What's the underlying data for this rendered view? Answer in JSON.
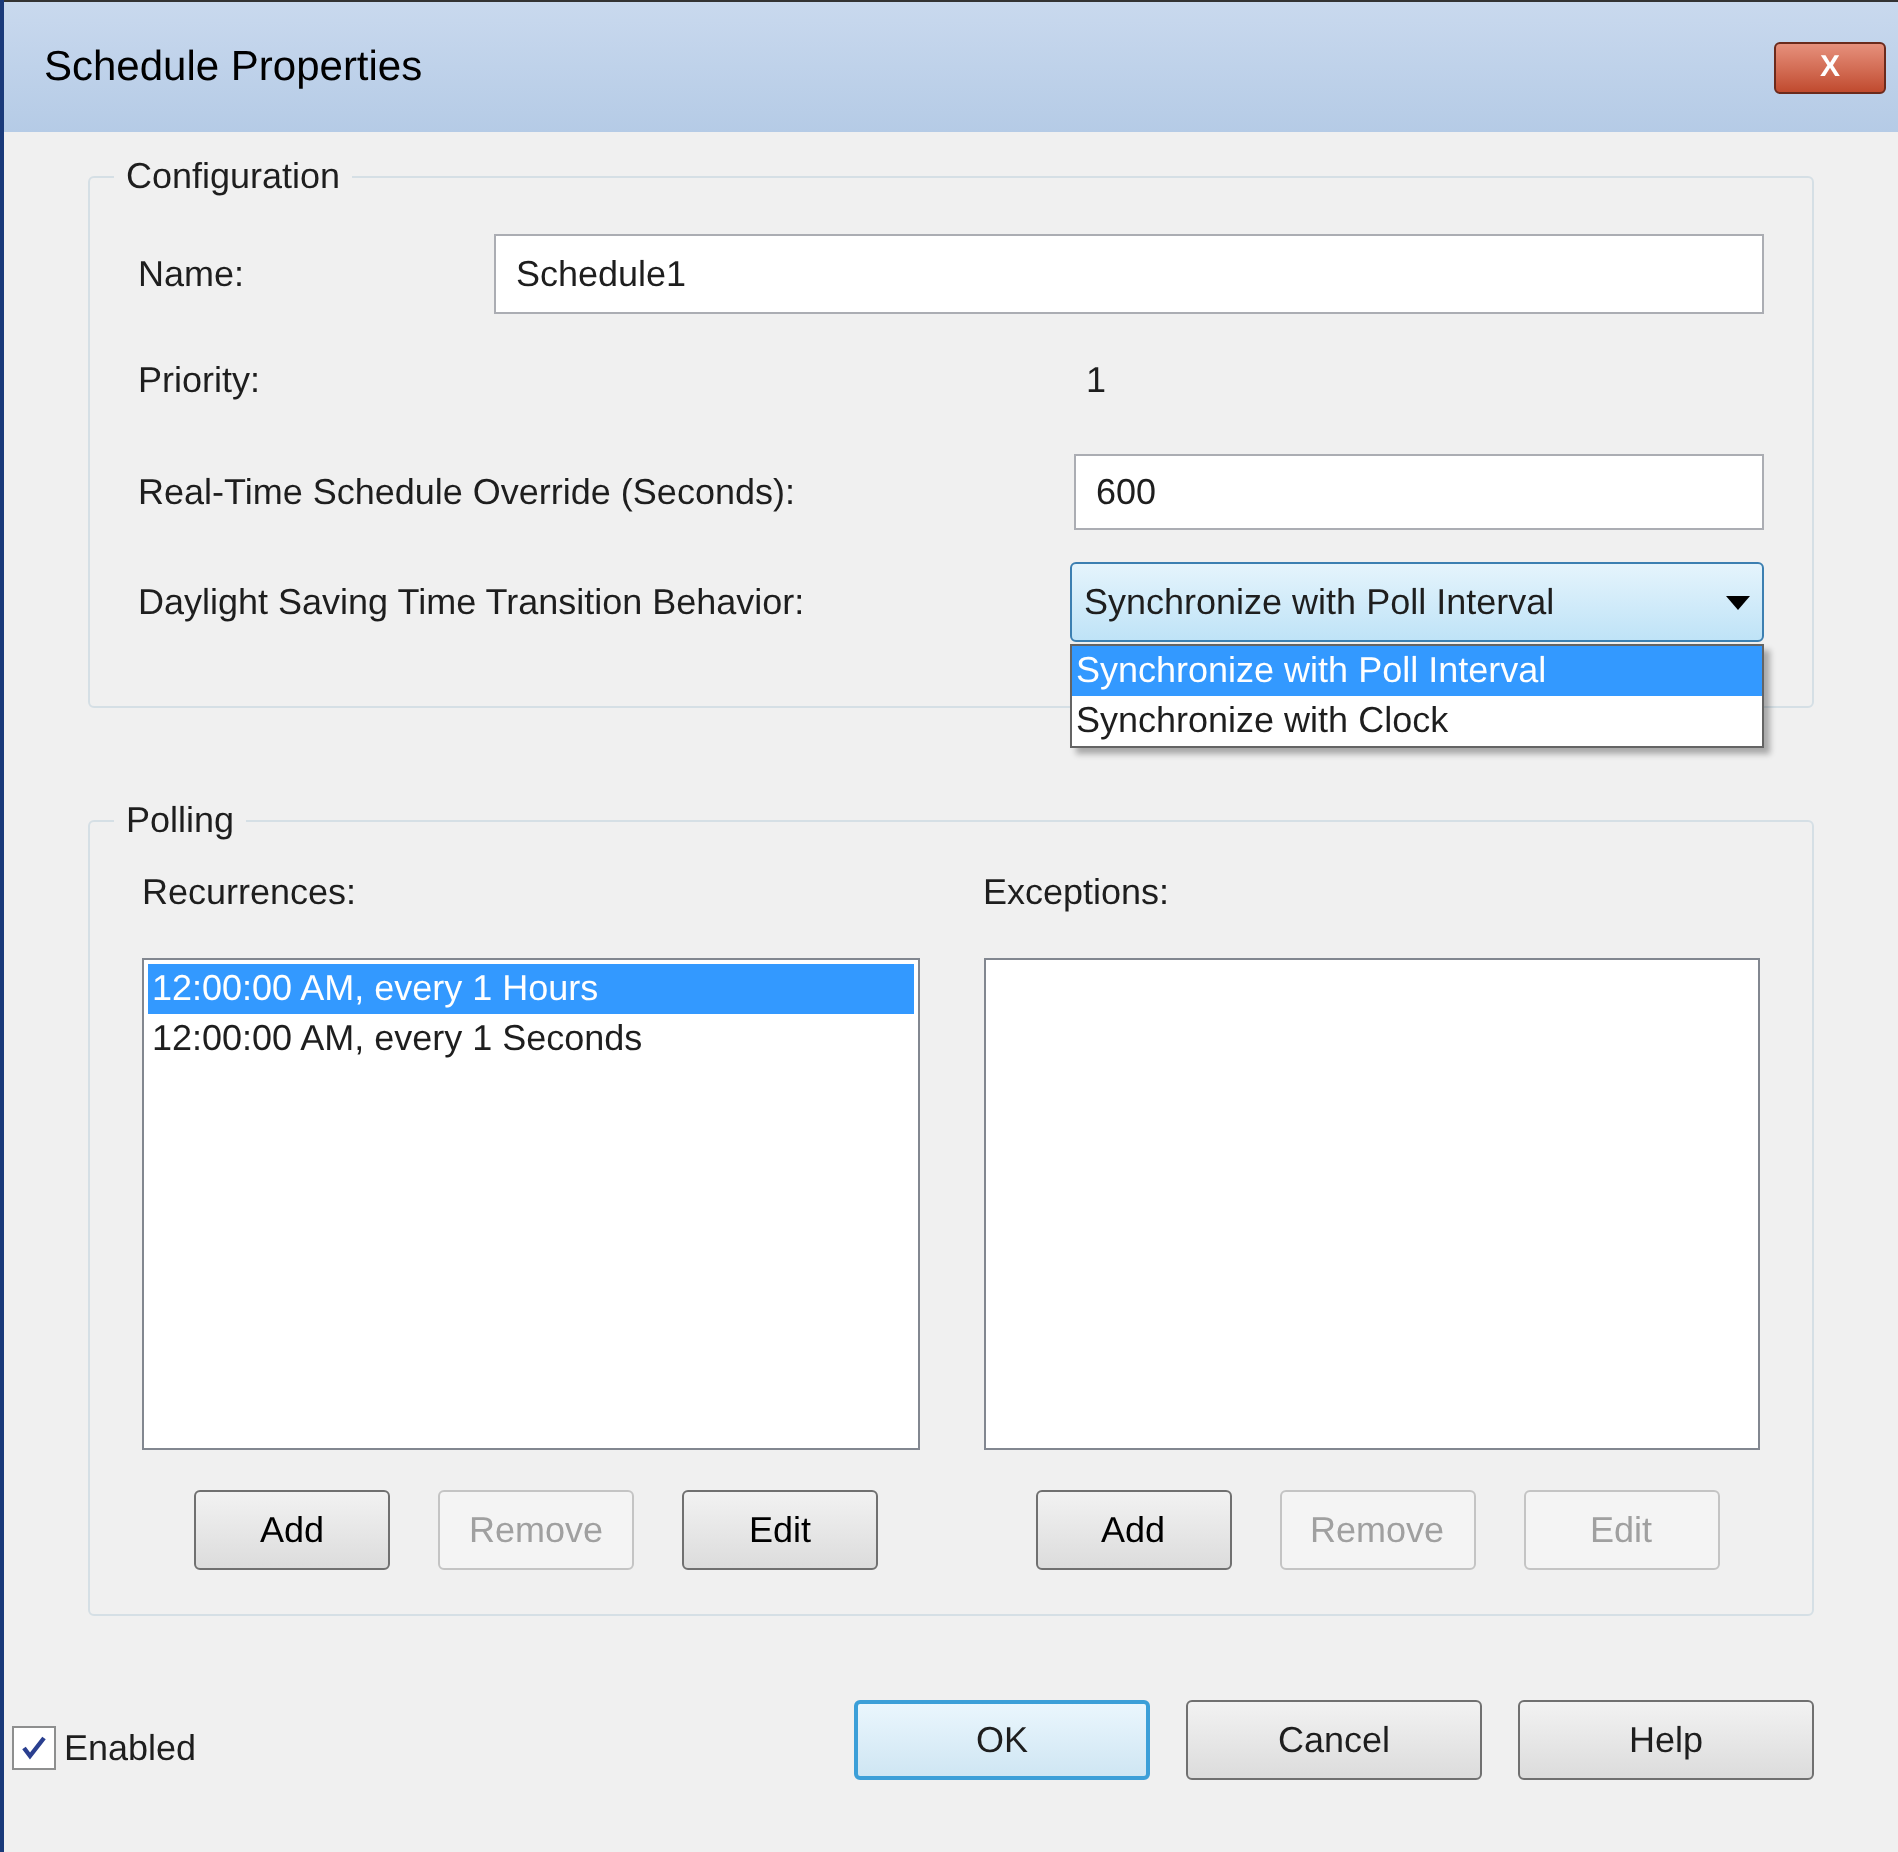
{
  "window": {
    "title": "Schedule Properties",
    "close_label": "X"
  },
  "configuration": {
    "title": "Configuration",
    "name": {
      "label": "Name:",
      "value": "Schedule1"
    },
    "priority": {
      "label": "Priority:",
      "value": "1"
    },
    "override": {
      "label": "Real-Time Schedule Override (Seconds):",
      "value": "600"
    },
    "dst": {
      "label": "Daylight Saving Time Transition Behavior:",
      "value": "Synchronize with Poll Interval",
      "expanded": true,
      "options": [
        {
          "label": "Synchronize with Poll Interval",
          "selected": true
        },
        {
          "label": "Synchronize with Clock",
          "selected": false
        }
      ]
    }
  },
  "polling": {
    "title": "Polling",
    "recurrences": {
      "label": "Recurrences:",
      "items": [
        {
          "label": "12:00:00 AM, every 1 Hours",
          "selected": true
        },
        {
          "label": "12:00:00 AM, every 1 Seconds",
          "selected": false
        }
      ],
      "buttons": [
        {
          "label": "Add",
          "disabled": false
        },
        {
          "label": "Remove",
          "disabled": true
        },
        {
          "label": "Edit",
          "disabled": false
        }
      ]
    },
    "exceptions": {
      "label": "Exceptions:",
      "buttons": [
        {
          "label": "Add",
          "disabled": false
        },
        {
          "label": "Remove",
          "disabled": true
        },
        {
          "label": "Edit",
          "disabled": true
        }
      ]
    }
  },
  "enabled": {
    "label": "Enabled",
    "checked": true
  },
  "footer_buttons": [
    {
      "label": "OK",
      "default": true
    },
    {
      "label": "Cancel",
      "default": false
    },
    {
      "label": "Help",
      "default": false
    }
  ]
}
